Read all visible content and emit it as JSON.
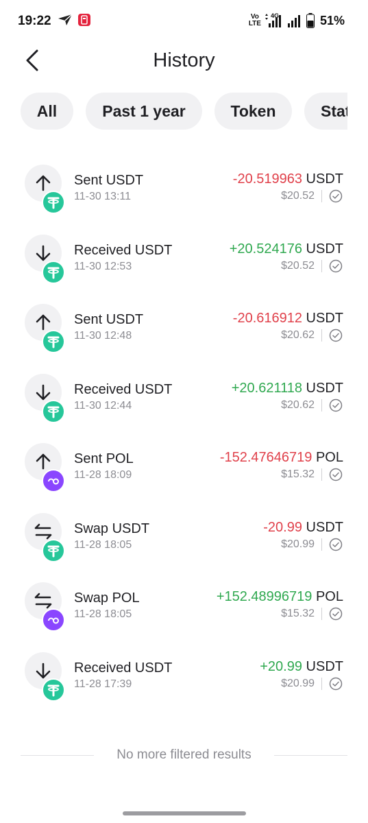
{
  "status_bar": {
    "time": "19:22",
    "volte_top": "Vo",
    "volte_bottom": "LTE",
    "network": "4G",
    "battery": "51%"
  },
  "header": {
    "title": "History"
  },
  "filters": [
    {
      "label": "All"
    },
    {
      "label": "Past 1 year"
    },
    {
      "label": "Token"
    },
    {
      "label": "Stat"
    }
  ],
  "transactions": [
    {
      "type": "sent",
      "title": "Sent USDT",
      "time": "11-30 13:11",
      "amount": "-20.519963",
      "unit": "USDT",
      "fiat": "$20.52",
      "token": "usdt",
      "sign": "neg"
    },
    {
      "type": "received",
      "title": "Received USDT",
      "time": "11-30 12:53",
      "amount": "+20.524176",
      "unit": "USDT",
      "fiat": "$20.52",
      "token": "usdt",
      "sign": "pos"
    },
    {
      "type": "sent",
      "title": "Sent USDT",
      "time": "11-30 12:48",
      "amount": "-20.616912",
      "unit": "USDT",
      "fiat": "$20.62",
      "token": "usdt",
      "sign": "neg"
    },
    {
      "type": "received",
      "title": "Received USDT",
      "time": "11-30 12:44",
      "amount": "+20.621118",
      "unit": "USDT",
      "fiat": "$20.62",
      "token": "usdt",
      "sign": "pos"
    },
    {
      "type": "sent",
      "title": "Sent POL",
      "time": "11-28 18:09",
      "amount": "-152.47646719",
      "unit": "POL",
      "fiat": "$15.32",
      "token": "pol",
      "sign": "neg"
    },
    {
      "type": "swap",
      "title": "Swap USDT",
      "time": "11-28 18:05",
      "amount": "-20.99",
      "unit": "USDT",
      "fiat": "$20.99",
      "token": "usdt",
      "sign": "neg"
    },
    {
      "type": "swap",
      "title": "Swap POL",
      "time": "11-28 18:05",
      "amount": "+152.48996719",
      "unit": "POL",
      "fiat": "$15.32",
      "token": "pol",
      "sign": "pos"
    },
    {
      "type": "received",
      "title": "Received USDT",
      "time": "11-28 17:39",
      "amount": "+20.99",
      "unit": "USDT",
      "fiat": "$20.99",
      "token": "usdt",
      "sign": "pos"
    }
  ],
  "footer": {
    "no_more": "No more filtered results"
  },
  "colors": {
    "negative": "#e0404a",
    "positive": "#2fa84f",
    "usdt": "#26c79a",
    "pol": "#8a46ff"
  }
}
